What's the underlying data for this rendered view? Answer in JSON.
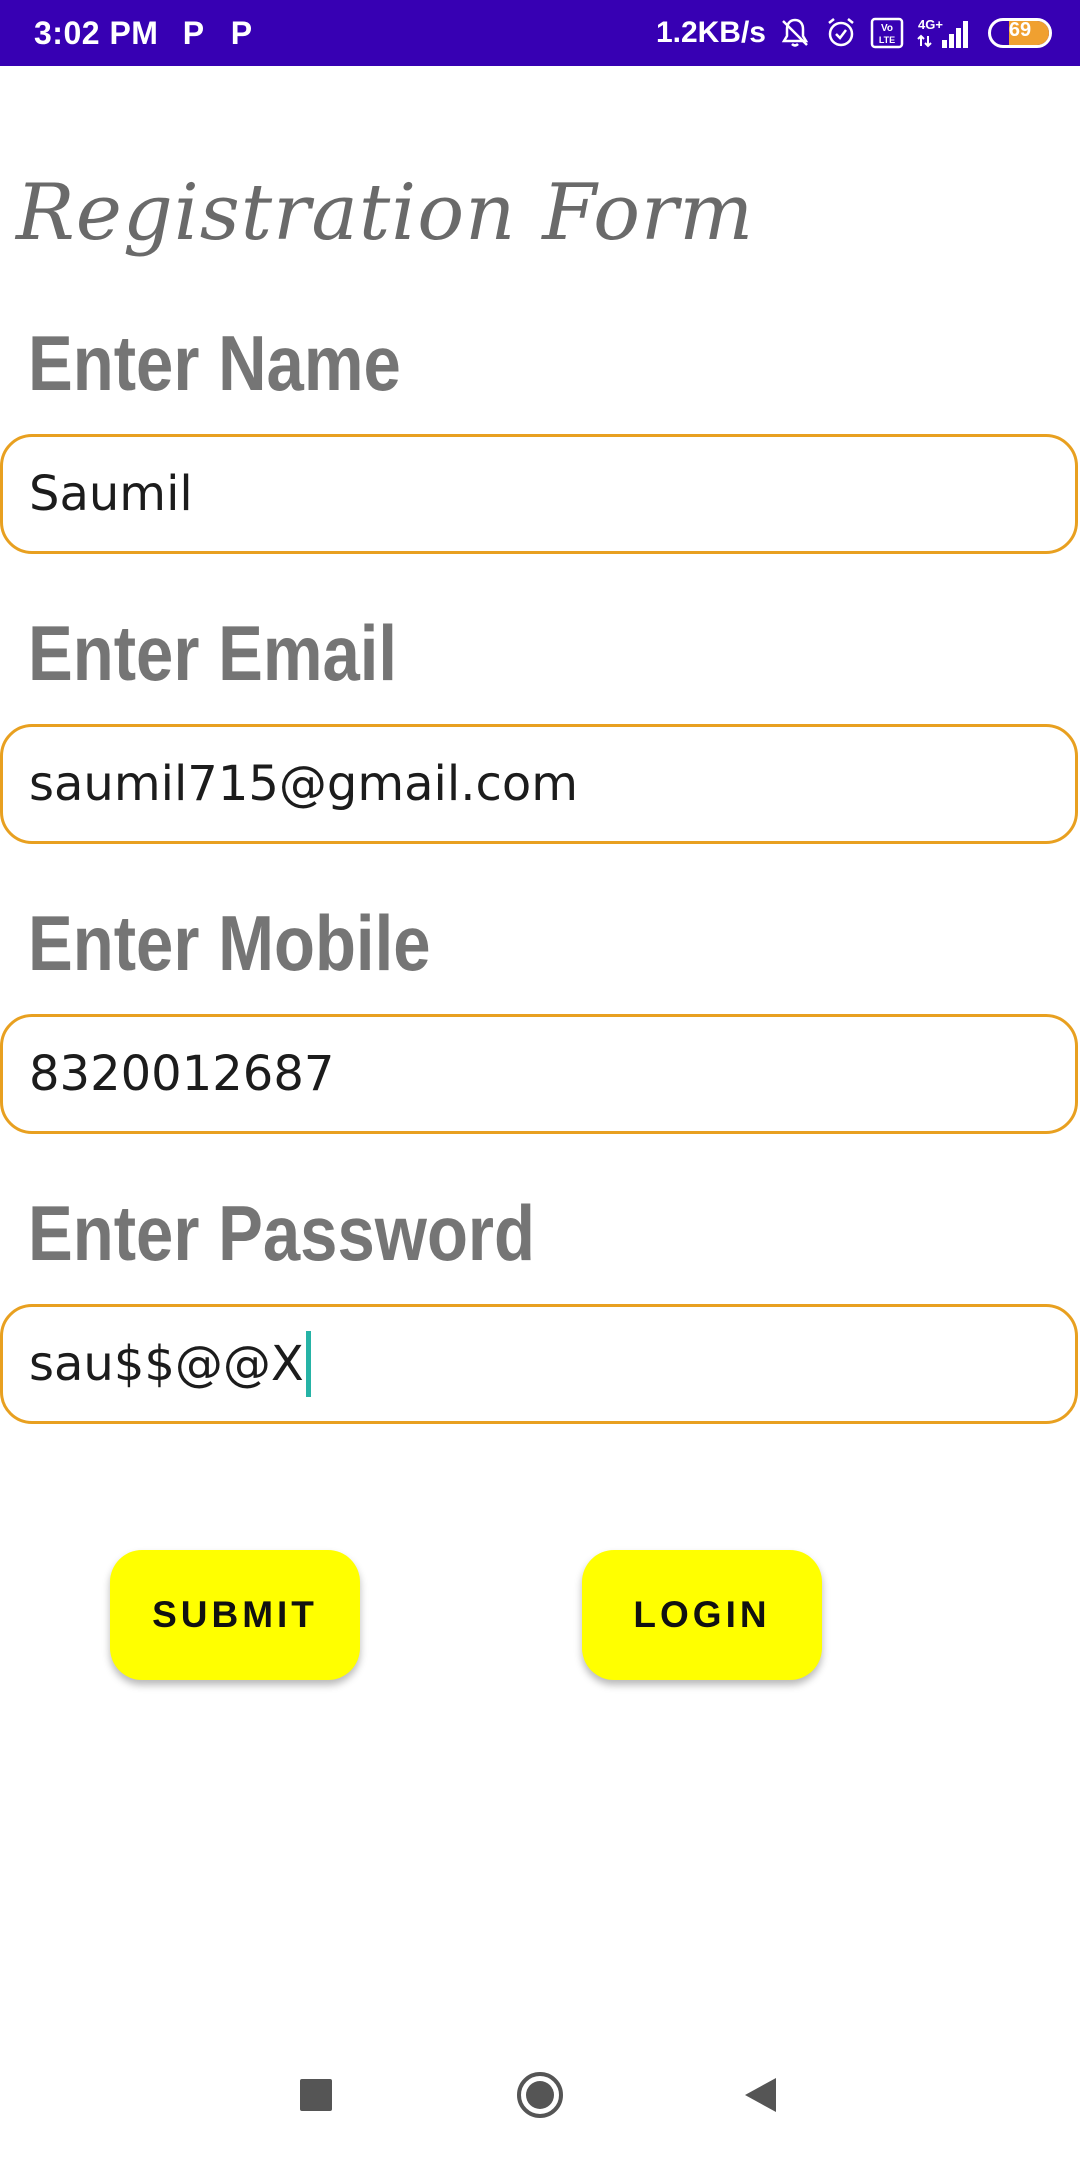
{
  "status_bar": {
    "time": "3:02 PM",
    "notif_1": "P",
    "notif_2": "P",
    "network_speed": "1.2KB/s",
    "network_type": "4G+",
    "volte_label": "Vo LTE",
    "battery_level": "69",
    "battery_fraction": 0.69,
    "color": "#3700b3"
  },
  "form": {
    "title": "Registration Form",
    "fields": [
      {
        "label": "Enter Name",
        "value": "Saumil"
      },
      {
        "label": "Enter Email",
        "value": "saumil715@gmail.com"
      },
      {
        "label": "Enter Mobile",
        "value": "8320012687"
      },
      {
        "label": "Enter Password",
        "value": "sau$$@@X"
      }
    ],
    "border_color": "#e8a020"
  },
  "buttons": {
    "submit_label": "SUBMIT",
    "login_label": "LOGIN",
    "color": "#ffff00"
  },
  "nav": {
    "recents": "square-icon",
    "home": "circle-icon",
    "back": "triangle-back-icon"
  }
}
